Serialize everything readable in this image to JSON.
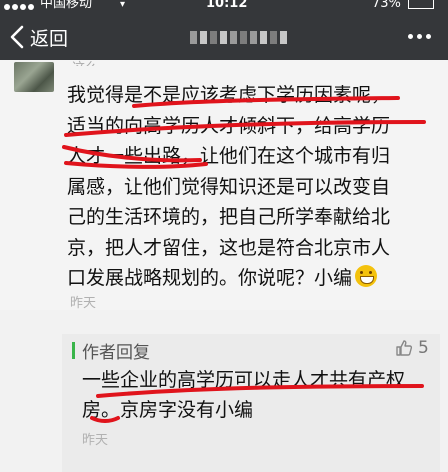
{
  "status_bar": {
    "carrier": "中国移动",
    "time": "10:12",
    "battery": "73%"
  },
  "nav": {
    "back_label": "返回"
  },
  "comment": {
    "username": "这么",
    "lines": [
      "我觉得是不是应该考虑下学历因素呢，",
      "适当的向高学历人才倾斜下，给高学历",
      "人才一些出路，让他们在这个城市有归",
      "属感，让他们觉得知识还是可以改变自",
      "己的生活环境的，把自己所学奉献给北",
      "京，把人才留住，这也是符合北京市人",
      "口发展战略规划的。你说呢？小编"
    ],
    "emoji": "grinning-face",
    "time": "昨天"
  },
  "reply": {
    "author_label": "作者回复",
    "likes": "5",
    "lines": [
      "一些企业的高学历可以走人才共有产权",
      "房。京房字没有小编"
    ],
    "time": "昨天"
  },
  "colors": {
    "nav_bg": "#35373a",
    "annotation": "#e0141c",
    "reply_marker": "#39b54a"
  }
}
